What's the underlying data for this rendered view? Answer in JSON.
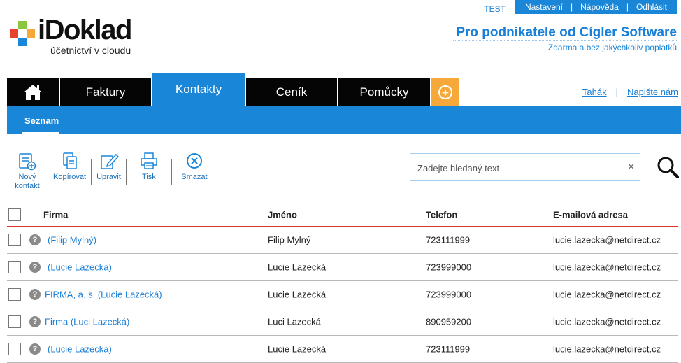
{
  "top": {
    "env_label": "TEST",
    "links": [
      "Nastavení",
      "Nápověda",
      "Odhlásit"
    ],
    "separator": "|"
  },
  "logo": {
    "name": "iDoklad",
    "tagline": "účetnictví v cloudu"
  },
  "promo": {
    "title": "Pro podnikatele od Cígler Software",
    "subtitle": "Zdarma a bez jakýchkoliv poplatků"
  },
  "nav": {
    "tabs": [
      "Faktury",
      "Kontakty",
      "Ceník",
      "Pomůcky"
    ],
    "active_tab": "Kontakty",
    "plus": "+",
    "right_links": [
      "Tahák",
      "Napište nám"
    ],
    "separator": "|"
  },
  "subnav": {
    "items": [
      "Seznam"
    ]
  },
  "toolbar": {
    "new_contact": "Nový kontakt",
    "copy": "Kopírovat",
    "edit": "Upravit",
    "print": "Tisk",
    "delete": "Smazat"
  },
  "search": {
    "placeholder": "Zadejte hledaný text",
    "value": "",
    "clear": "×"
  },
  "table": {
    "columns": [
      "Firma",
      "Jméno",
      "Telefon",
      "E-mailová adresa"
    ],
    "rows": [
      {
        "firma": "(Filip Mylný)",
        "jmeno": "Filip Mylný",
        "telefon": "723111999",
        "email": "lucie.lazecka@netdirect.cz"
      },
      {
        "firma": "(Lucie Lazecká)",
        "jmeno": "Lucie Lazecká",
        "telefon": "723999000",
        "email": "lucie.lazecka@netdirect.cz"
      },
      {
        "firma": "FIRMA, a. s. (Lucie Lazecká)",
        "jmeno": "Lucie Lazecká",
        "telefon": "723999000",
        "email": "lucie.lazecka@netdirect.cz"
      },
      {
        "firma": "Firma (Luci Lazecká)",
        "jmeno": "Luci Lazecká",
        "telefon": "890959200",
        "email": "lucie.lazecka@netdirect.cz"
      },
      {
        "firma": "(Lucie Lazecká)",
        "jmeno": "Lucie Lazecká",
        "telefon": "723111999",
        "email": "lucie.lazecka@netdirect.cz"
      }
    ],
    "row_icon": "?"
  },
  "colors": {
    "accent": "#1a86d8",
    "nav_dark": "#050505",
    "plus_tab": "#f6a83a",
    "header_rule": "#d8342c"
  }
}
